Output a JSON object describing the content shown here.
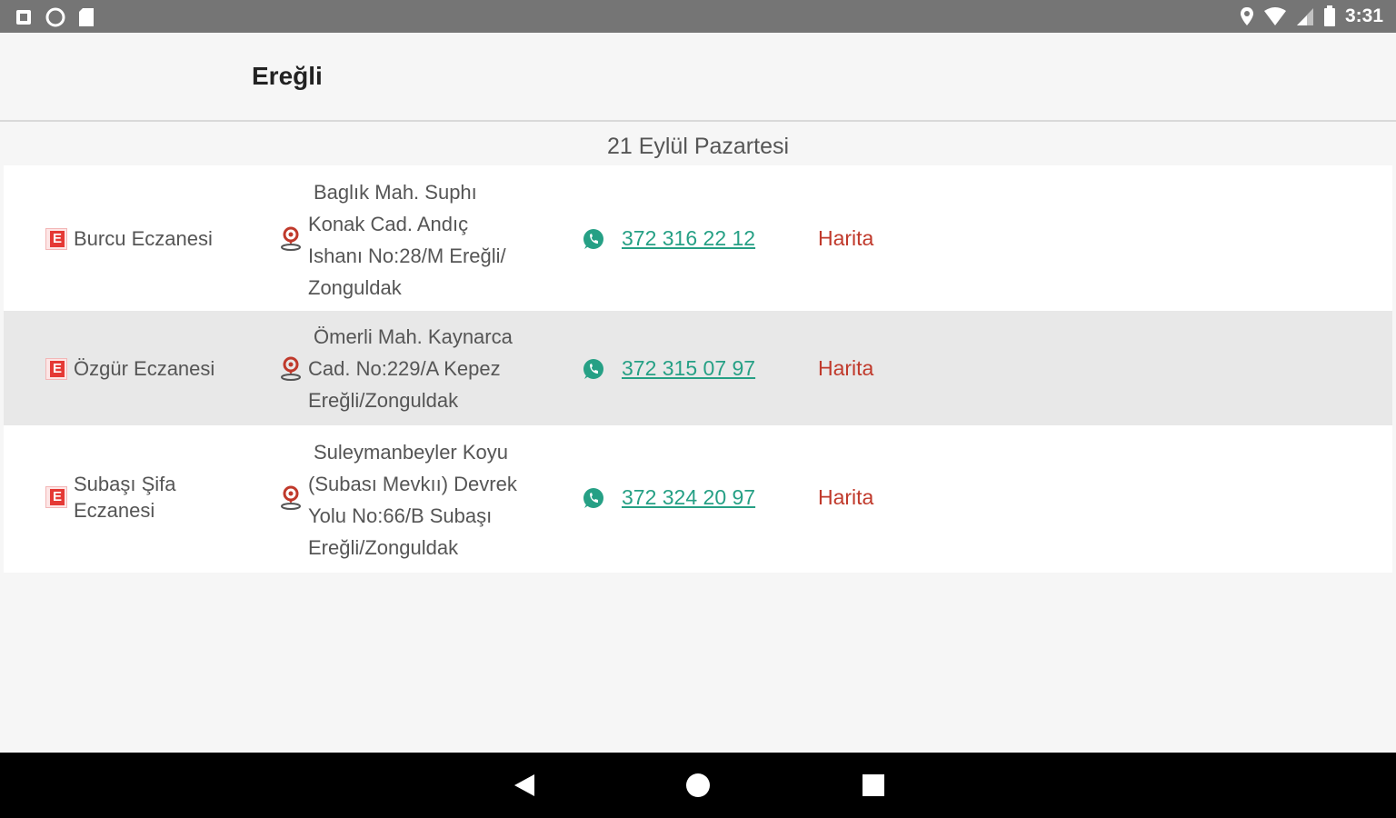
{
  "status_bar": {
    "time": "3:31",
    "left_icons": [
      "notification-icon",
      "circle-icon",
      "sd-card-icon"
    ],
    "right_icons": [
      "location-icon",
      "wifi-icon",
      "signal-icon",
      "battery-icon"
    ]
  },
  "app_bar": {
    "title": "Ereğli"
  },
  "date_header": "21 Eylül Pazartesi",
  "pharmacies": [
    {
      "name_lines": [
        "Burcu Eczanesi"
      ],
      "address_lines": [
        "Baglık Mah. Suphı",
        "Konak Cad. Andıç",
        "Ishanı No:28/M Ereğli/",
        "Zonguldak"
      ],
      "phone": "372 316 22 12",
      "map_label": "Harita"
    },
    {
      "name_lines": [
        "Özgür Eczanesi"
      ],
      "address_lines": [
        "Ömerli Mah. Kaynarca",
        "Cad. No:229/A   Kepez",
        "Ereğli/Zonguldak"
      ],
      "phone": "372 315 07 97",
      "map_label": "Harita"
    },
    {
      "name_lines": [
        "Subaşı Şifa",
        "Eczanesi"
      ],
      "address_lines": [
        "Suleymanbeyler Koyu",
        "(Subası Mevkıı) Devrek",
        "Yolu No:66/B   Subaşı",
        "Ereğli/Zonguldak"
      ],
      "phone": "372 324 20 97",
      "map_label": "Harita"
    }
  ],
  "colors": {
    "phone": "#26a085",
    "map_link": "#c0392b",
    "pharmacy_badge": "#e53935",
    "status_bar": "#757575"
  },
  "nav_bar": [
    "back-icon",
    "home-icon",
    "recents-icon"
  ]
}
